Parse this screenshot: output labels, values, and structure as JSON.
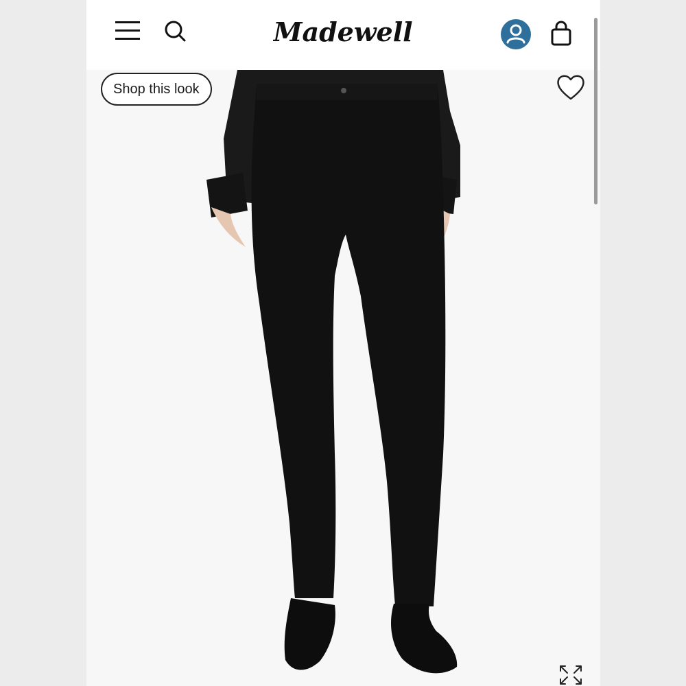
{
  "header": {
    "logo_text": "Madewell",
    "icons": {
      "menu": "hamburger-icon",
      "search": "search-icon",
      "account": "user-icon",
      "bag": "shopping-bag-icon"
    }
  },
  "product": {
    "shop_look_label": "Shop this look",
    "favorite_icon": "heart-icon",
    "expand_icon": "expand-icon"
  },
  "colors": {
    "account_badge": "#2f6f9c",
    "denim": "#111111",
    "page_background": "#f7f7f7"
  }
}
